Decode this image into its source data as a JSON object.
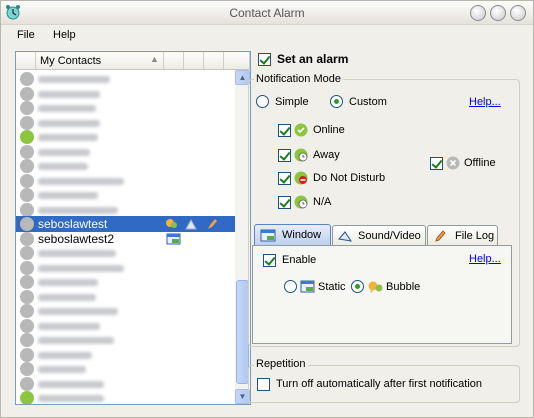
{
  "window": {
    "title": "Contact Alarm"
  },
  "menu": {
    "file": "File",
    "help": "Help"
  },
  "contacts": {
    "header": "My Contacts",
    "selected_index": 10,
    "rows": [
      {
        "status": "offline"
      },
      {
        "status": "offline"
      },
      {
        "status": "offline"
      },
      {
        "status": "offline"
      },
      {
        "status": "away"
      },
      {
        "status": "offline"
      },
      {
        "status": "offline"
      },
      {
        "status": "offline"
      },
      {
        "status": "offline"
      },
      {
        "status": "offline"
      },
      {
        "name": "seboslawtest",
        "status": "offline"
      },
      {
        "name": "seboslawtest2",
        "status": "offline"
      },
      {
        "status": "offline"
      },
      {
        "status": "offline"
      },
      {
        "status": "offline"
      },
      {
        "status": "offline"
      },
      {
        "status": "offline"
      },
      {
        "status": "offline"
      },
      {
        "status": "offline"
      },
      {
        "status": "offline"
      },
      {
        "status": "offline"
      },
      {
        "status": "offline"
      },
      {
        "status": "online"
      },
      {
        "status": "offline"
      }
    ]
  },
  "alarm": {
    "set_alarm": "Set an alarm",
    "notification_mode": "Notification Mode",
    "simple": "Simple",
    "custom": "Custom",
    "help": "Help...",
    "online": "Online",
    "away": "Away",
    "dnd": "Do Not Disturb",
    "na": "N/A",
    "offline": "Offline"
  },
  "tabs": {
    "window": "Window",
    "sound": "Sound/Video",
    "filelog": "File Log"
  },
  "window_tab": {
    "enable": "Enable",
    "help": "Help...",
    "static": "Static",
    "bubble": "Bubble"
  },
  "repetition": {
    "title": "Repetition",
    "turnoff": "Turn off automatically after first notification"
  },
  "colors": {
    "selection": "#316ac5",
    "online": "#8cc63f",
    "link": "#0000ff"
  }
}
